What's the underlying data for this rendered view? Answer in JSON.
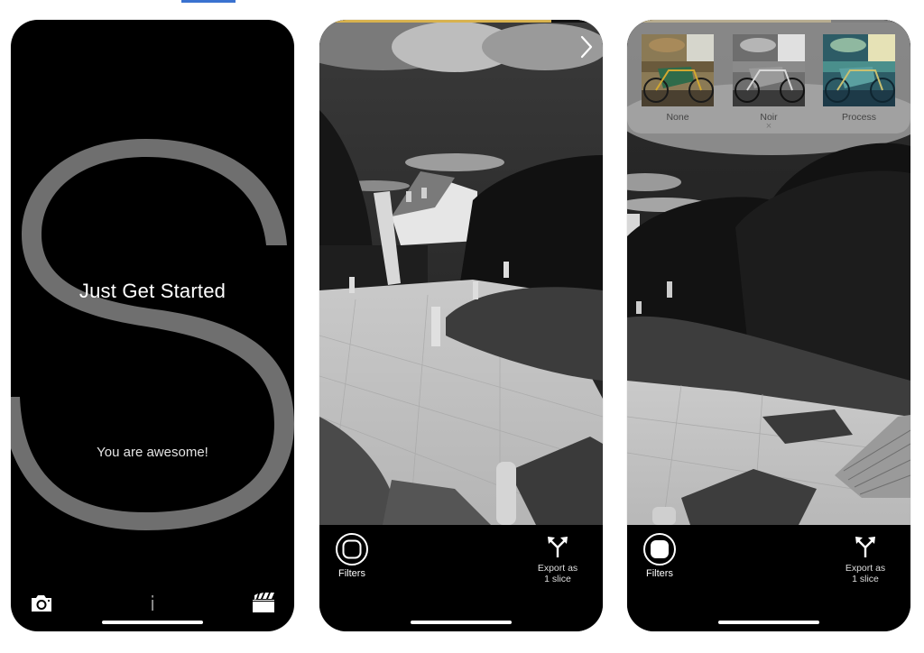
{
  "page": {
    "accent_top_indicator": "#3a72d0"
  },
  "screens": [
    {
      "id": "welcome",
      "background_letter": "S",
      "title": "Just Get Started",
      "subtitle": "You are awesome!",
      "bottom_bar": {
        "left_icon": "camera-icon",
        "center_icon": "info-icon",
        "center_glyph": "i",
        "right_icon": "clapperboard-icon"
      }
    },
    {
      "id": "photo-preview",
      "progress": 0.82,
      "progress_color": "#d8b24e",
      "next_icon": "chevron-right-icon",
      "toolbar": {
        "filters_label": "Filters",
        "filters_icon": "filters-outline-icon",
        "export_label_line1": "Export as",
        "export_label_line2": "1 slice",
        "export_icon": "split-arrow-icon"
      }
    },
    {
      "id": "photo-filters",
      "progress": 0.72,
      "progress_color": "#d8b24e",
      "filters": [
        {
          "label": "None",
          "style": "color"
        },
        {
          "label": "Noir",
          "style": "grayscale"
        },
        {
          "label": "Process",
          "style": "cyan-tint"
        }
      ],
      "close_glyph": "×",
      "toolbar": {
        "filters_label": "Filters",
        "filters_icon": "filters-filled-icon",
        "export_label_line1": "Export as",
        "export_label_line2": "1 slice",
        "export_icon": "split-arrow-icon"
      }
    }
  ]
}
